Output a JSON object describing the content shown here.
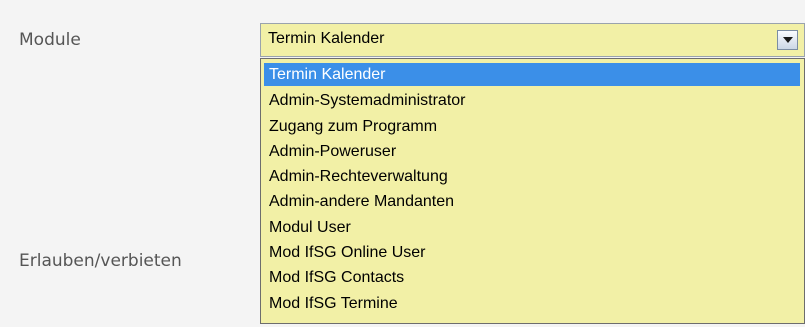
{
  "form": {
    "module_label": "Module",
    "permission_label": "Erlauben/verbieten"
  },
  "module_select": {
    "selected_value": "Termin Kalender",
    "options": [
      "Termin Kalender",
      "Admin-Systemadministrator",
      "Zugang zum Programm",
      "Admin-Poweruser",
      "Admin-Rechteverwaltung",
      "Admin-andere Mandanten",
      "Modul User",
      "Mod IfSG Online User",
      "Mod IfSG Contacts",
      "Mod IfSG Termine"
    ],
    "highlighted_index": 0
  },
  "icons": {
    "dropdown_arrow": "chevron-down-icon"
  },
  "colors": {
    "field_background": "#f2f0a6",
    "highlight": "#3b8fe8",
    "label_text": "#555555"
  }
}
